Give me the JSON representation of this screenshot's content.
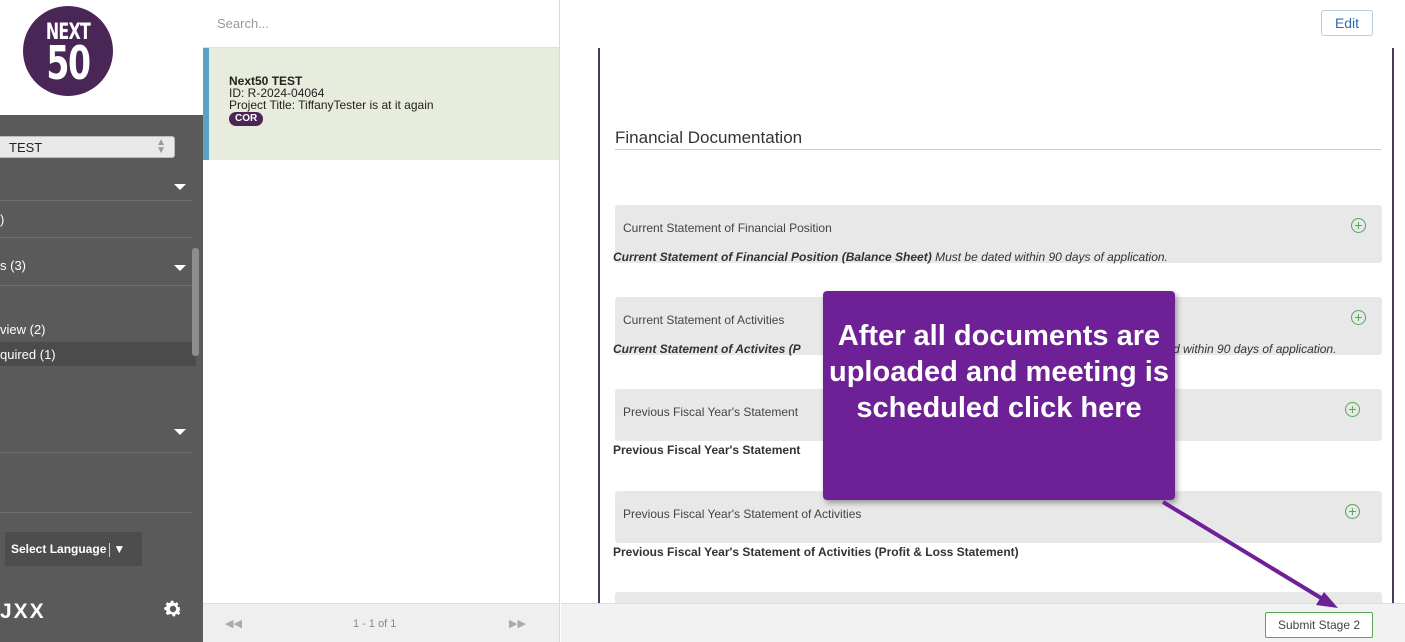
{
  "sidebar": {
    "logo": {
      "line1": "NEXT",
      "line2": "50",
      "mark": "®"
    },
    "org_select": {
      "value": "TEST"
    },
    "rows": [
      {
        "label": ")"
      },
      {
        "label": "s (3)"
      },
      {
        "label": "view  (2)"
      },
      {
        "label": "quired  (1)"
      }
    ],
    "language": {
      "label": "Select Language",
      "arrow": "▼"
    },
    "user_initials": "JXX",
    "icons": {
      "settings": "gear-icon"
    }
  },
  "list": {
    "search": {
      "placeholder": "Search..."
    },
    "items": [
      {
        "name": "Next50 TEST",
        "id_line": "ID: R-2024-04064",
        "title_line": "Project Title: TiffanyTester is at it again",
        "badge": "COR"
      }
    ],
    "pager": {
      "prev": "◀◀",
      "count": "1 - 1 of 1",
      "next": "▶▶"
    }
  },
  "main": {
    "edit_label": "Edit",
    "section_title": "Financial Documentation",
    "documents": [
      {
        "header": "Current Statement of Financial Position",
        "desc_bold": "Current Statement of Financial Position (Balance Sheet)",
        "desc_rest": " Must be dated within 90 days of application."
      },
      {
        "header": "Current Statement of Activities",
        "desc_bold": "Current Statement of Activites (P",
        "desc_rest": "d within 90 days of application."
      },
      {
        "header": "Previous Fiscal Year's Statement",
        "desc_bold": "Previous Fiscal Year's Statement",
        "desc_rest": ""
      },
      {
        "header": "Previous Fiscal Year's Statement of Activities",
        "desc_bold": "Previous Fiscal Year's Statement of Activities (Profit & Loss Statement)",
        "desc_rest": ""
      }
    ],
    "submit_label": "Submit Stage 2"
  },
  "callout": {
    "text": "After all documents are uploaded and meeting is scheduled click here"
  },
  "colors": {
    "brand_purple": "#4a2657",
    "callout_purple": "#6e2196",
    "sidebar_gray": "#5a5a5a",
    "selected_item": "#e7ecdd",
    "accent_blue": "#5aa3c7",
    "action_green": "#58a85a"
  }
}
